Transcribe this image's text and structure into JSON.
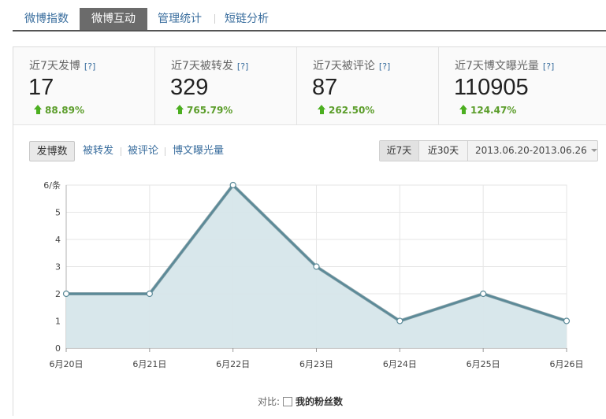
{
  "tabs": [
    {
      "label": "微博指数",
      "active": false
    },
    {
      "label": "微博互动",
      "active": true
    },
    {
      "label": "管理统计",
      "active": false
    },
    {
      "label": "短链分析",
      "active": false
    }
  ],
  "stats": [
    {
      "title": "近7天发博",
      "help": "[?]",
      "value": "17",
      "change": "88.89%"
    },
    {
      "title": "近7天被转发",
      "help": "[?]",
      "value": "329",
      "change": "765.79%"
    },
    {
      "title": "近7天被评论",
      "help": "[?]",
      "value": "87",
      "change": "262.50%"
    },
    {
      "title": "近7天博文曝光量",
      "help": "[?]",
      "value": "110905",
      "change": "124.47%"
    }
  ],
  "metrics": [
    {
      "label": "发博数",
      "active": true
    },
    {
      "label": "被转发",
      "active": false
    },
    {
      "label": "被评论",
      "active": false
    },
    {
      "label": "博文曝光量",
      "active": false
    }
  ],
  "range": {
    "options": [
      {
        "label": "近7天",
        "active": true
      },
      {
        "label": "近30天",
        "active": false
      }
    ],
    "date_range": "2013.06.20-2013.06.26"
  },
  "compare": {
    "label": "对比:",
    "option": "我的粉丝数",
    "checked": false
  },
  "colors": {
    "line": "#5b8a98",
    "area": "#d6e6ea",
    "up": "#4caf20",
    "link": "#3a6e9e"
  },
  "chart_data": {
    "type": "area",
    "categories": [
      "6月20日",
      "6月21日",
      "6月22日",
      "6月23日",
      "6月24日",
      "6月25日",
      "6月26日"
    ],
    "values": [
      2,
      2,
      6,
      3,
      1,
      2,
      1
    ],
    "yticks": [
      "0",
      "1",
      "2",
      "3",
      "4",
      "5",
      "6/条"
    ],
    "ylim": [
      0,
      6
    ],
    "grid": true
  }
}
